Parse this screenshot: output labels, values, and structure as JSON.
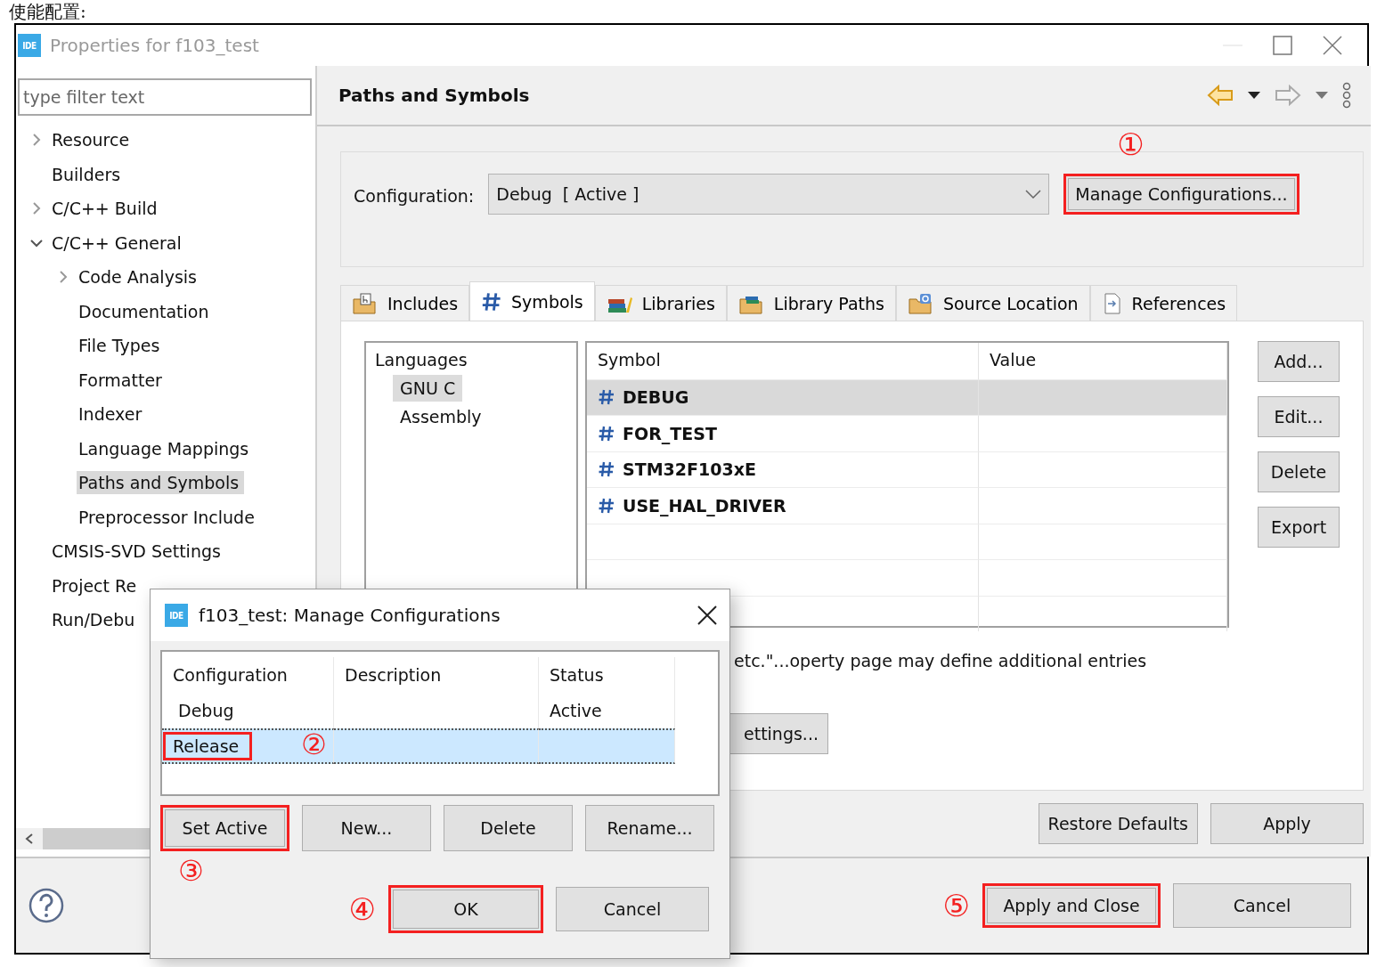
{
  "caption": "使能配置:",
  "window": {
    "app_icon": "IDE",
    "title": "Properties for f103_test"
  },
  "sidebar": {
    "filter": {
      "placeholder": "type filter text"
    },
    "items": [
      {
        "label": "Resource",
        "expanded": false,
        "selected": false
      },
      {
        "label": "Builders",
        "selected": false
      },
      {
        "label": "C/C++ Build",
        "expanded": false,
        "selected": false
      },
      {
        "label": "C/C++ General",
        "expanded": true,
        "selected": false,
        "children": [
          {
            "label": "Code Analysis",
            "expanded": false,
            "selected": false
          },
          {
            "label": "Documentation",
            "selected": false
          },
          {
            "label": "File Types",
            "selected": false
          },
          {
            "label": "Formatter",
            "selected": false
          },
          {
            "label": "Indexer",
            "selected": false
          },
          {
            "label": "Language Mappings",
            "selected": false
          },
          {
            "label": "Paths and Symbols",
            "selected": true
          },
          {
            "label": "Preprocessor Include",
            "selected": false
          }
        ]
      },
      {
        "label": "CMSIS-SVD Settings",
        "selected": false
      },
      {
        "label": "Project Re",
        "selected": false
      },
      {
        "label": "Run/Debu",
        "selected": false
      }
    ]
  },
  "page": {
    "title": "Paths and Symbols",
    "configuration": {
      "label": "Configuration:",
      "value": "Debug  [ Active ]"
    },
    "manage_button": {
      "label": "Manage Configurations...",
      "highlighted": true,
      "marker": "①"
    },
    "tabs": [
      {
        "label": "Includes",
        "kind": "include",
        "selected": false
      },
      {
        "label": "Symbols",
        "kind": "symbol",
        "selected": true
      },
      {
        "label": "Libraries",
        "kind": "library",
        "selected": false
      },
      {
        "label": "Library Paths",
        "kind": "librarypath",
        "selected": false
      },
      {
        "label": "Source Location",
        "kind": "source",
        "selected": false
      },
      {
        "label": "References",
        "kind": "reference",
        "selected": false
      }
    ],
    "languages": {
      "header": "Languages",
      "items": [
        {
          "label": "GNU C",
          "selected": true
        },
        {
          "label": "Assembly",
          "selected": false
        }
      ]
    },
    "symbols": {
      "columns": [
        "Symbol",
        "Value"
      ],
      "rows": [
        {
          "symbol": "DEBUG",
          "selected": true
        },
        {
          "symbol": "FOR_TEST",
          "selected": false
        },
        {
          "symbol": "STM32F103xE",
          "selected": false
        },
        {
          "symbol": "USE_HAL_DRIVER",
          "selected": false
        }
      ]
    },
    "side_buttons": [
      "Add...",
      "Edit...",
      "Delete",
      "Export"
    ],
    "note": "etc.\"...operty page may define additional entries",
    "settings_button": "ettings...",
    "page_buttons": [
      "Restore Defaults",
      "Apply"
    ]
  },
  "footer": {
    "buttons": [
      {
        "label": "Apply and Close",
        "highlighted": true,
        "marker": "⑤"
      },
      {
        "label": "Cancel",
        "highlighted": false
      }
    ]
  },
  "manage_dialog": {
    "app_icon": "IDE",
    "title": "f103_test: Manage Configurations",
    "columns": [
      "Configuration",
      "Description",
      "Status"
    ],
    "rows": [
      {
        "configuration": "Debug",
        "status": "Active",
        "selected": false,
        "highlighted": false
      },
      {
        "configuration": "Release",
        "selected": true,
        "highlighted": true,
        "marker": "②"
      }
    ],
    "buttons": [
      {
        "label": "Set Active",
        "highlighted": true,
        "marker": "③"
      },
      {
        "label": "New...",
        "highlighted": false
      },
      {
        "label": "Delete",
        "highlighted": false
      },
      {
        "label": "Rename...",
        "highlighted": false
      }
    ],
    "ok": {
      "label": "OK",
      "highlighted": true,
      "marker": "④"
    },
    "cancel": {
      "label": "Cancel",
      "highlighted": false
    }
  }
}
